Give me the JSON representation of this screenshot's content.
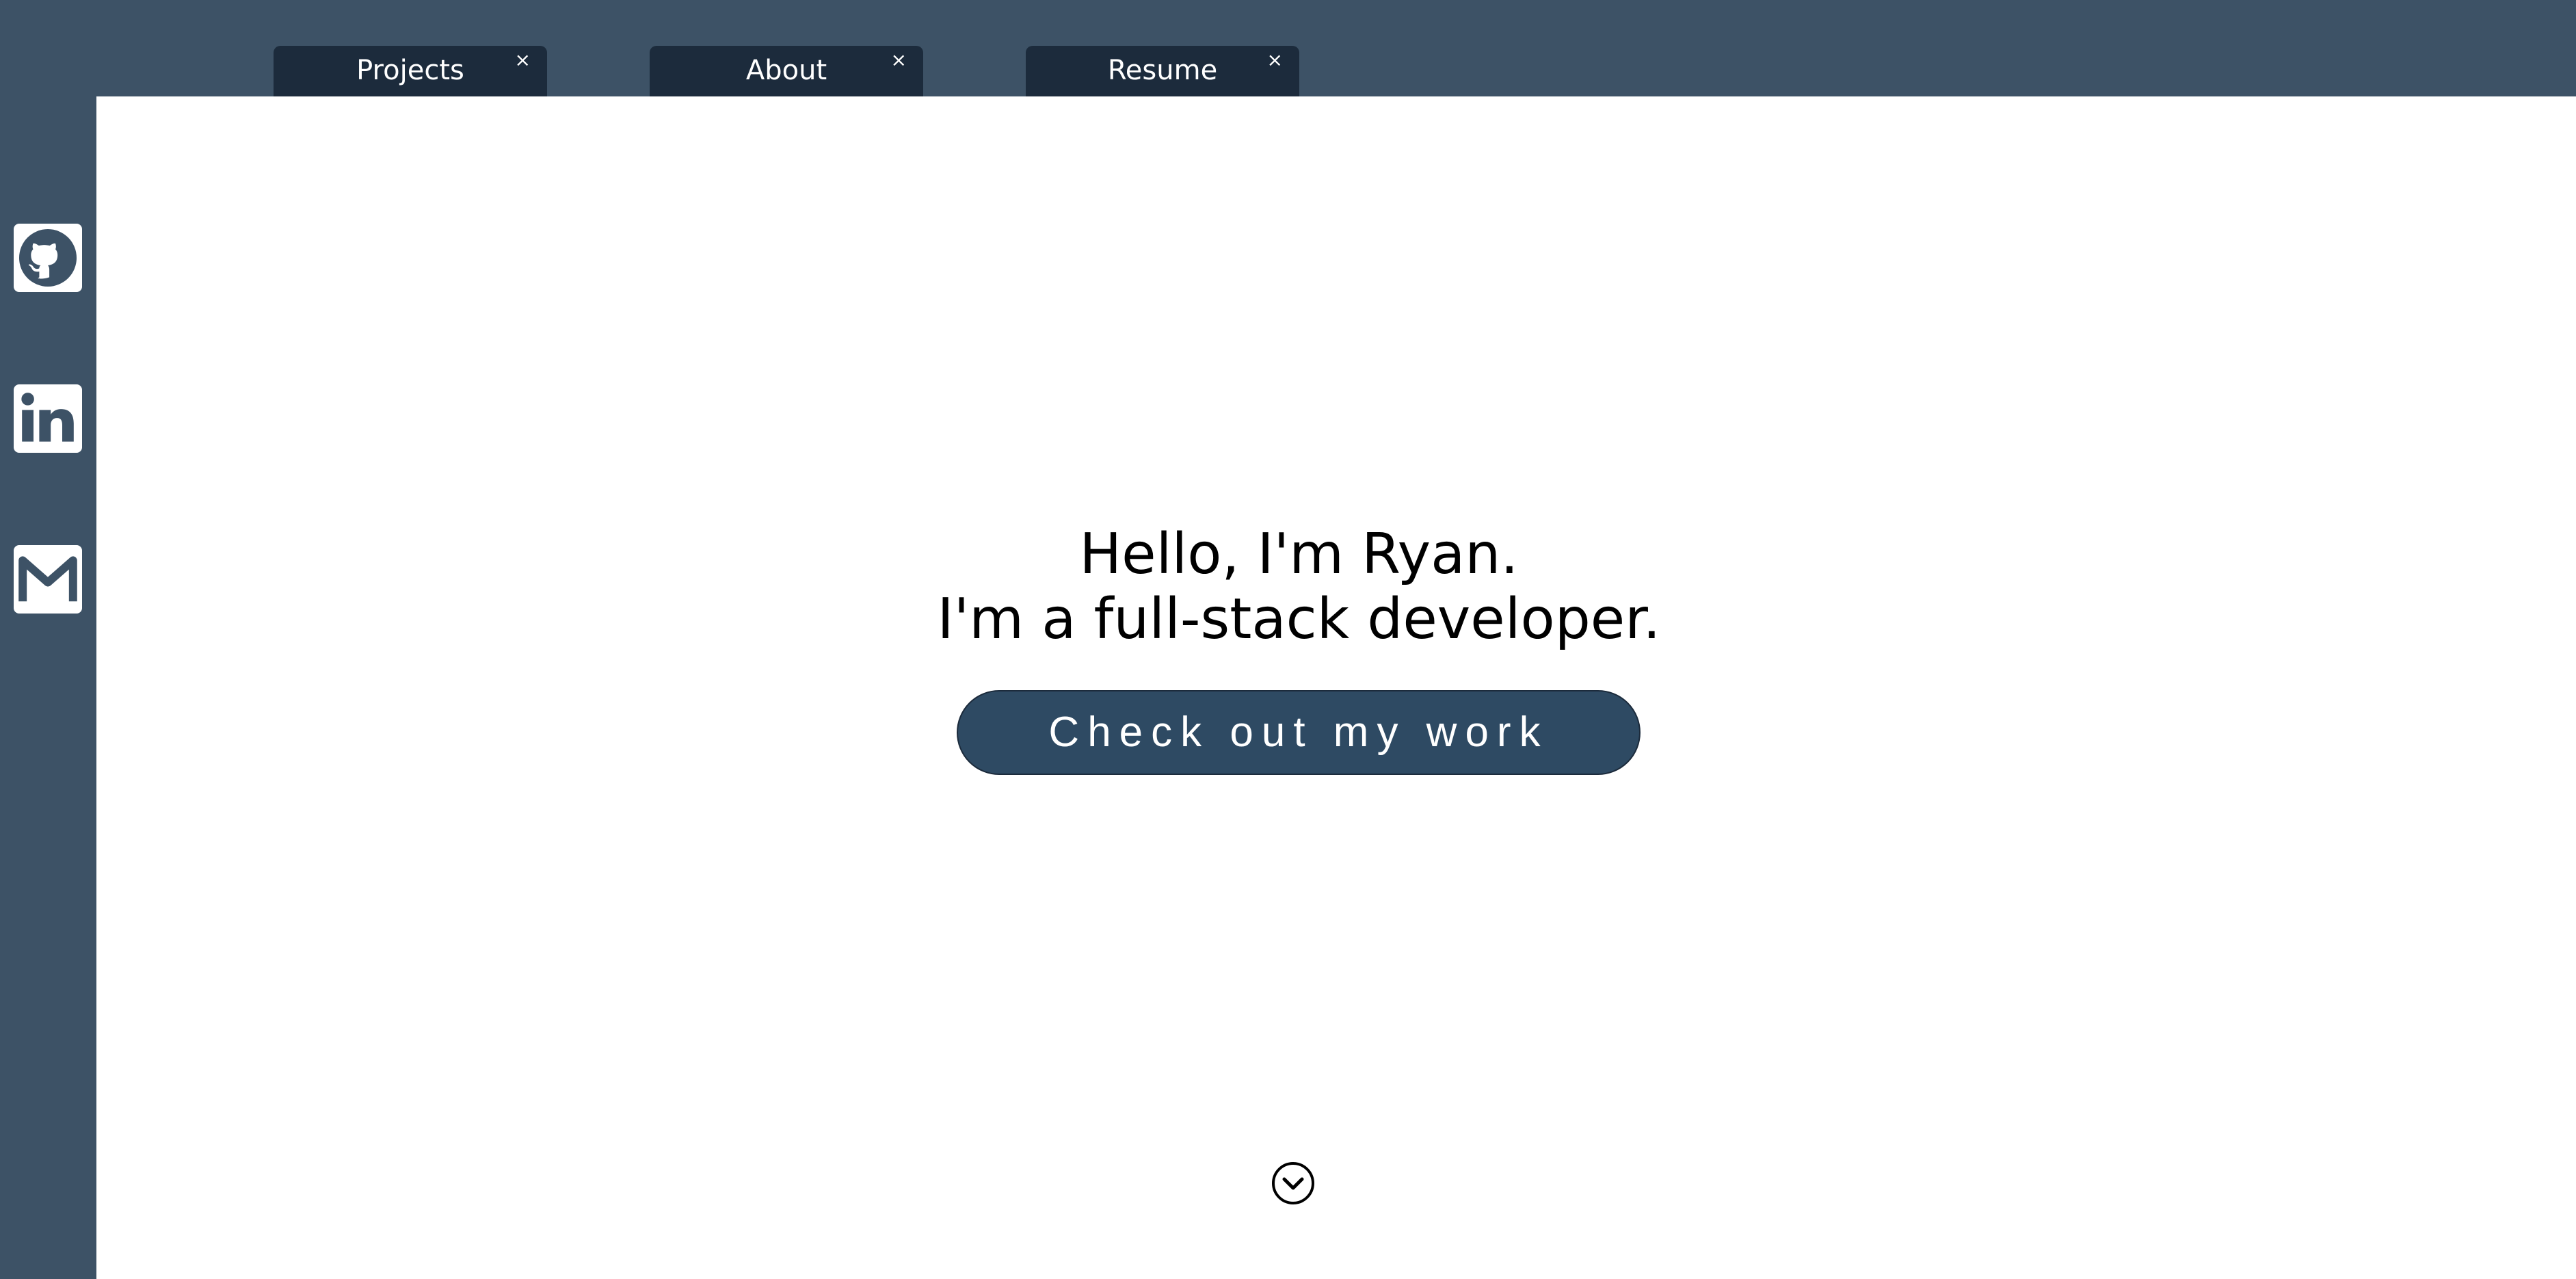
{
  "tabs": [
    {
      "label": "Projects",
      "close": "×"
    },
    {
      "label": "About",
      "close": "×"
    },
    {
      "label": "Resume",
      "close": "×"
    }
  ],
  "sidebar": {
    "items": [
      {
        "icon": "github-icon"
      },
      {
        "icon": "linkedin-icon"
      },
      {
        "icon": "gmail-icon"
      }
    ]
  },
  "hero": {
    "line1": "Hello, I'm Ryan.",
    "line2": "I'm a full-stack developer.",
    "cta_label": "Check out my work"
  },
  "scroll": {
    "icon": "chevron-down-circle-icon"
  },
  "colors": {
    "frame": "#3d5266",
    "tab": "#1c2b3c",
    "button": "#2e4a63",
    "content_bg": "#ffffff"
  }
}
